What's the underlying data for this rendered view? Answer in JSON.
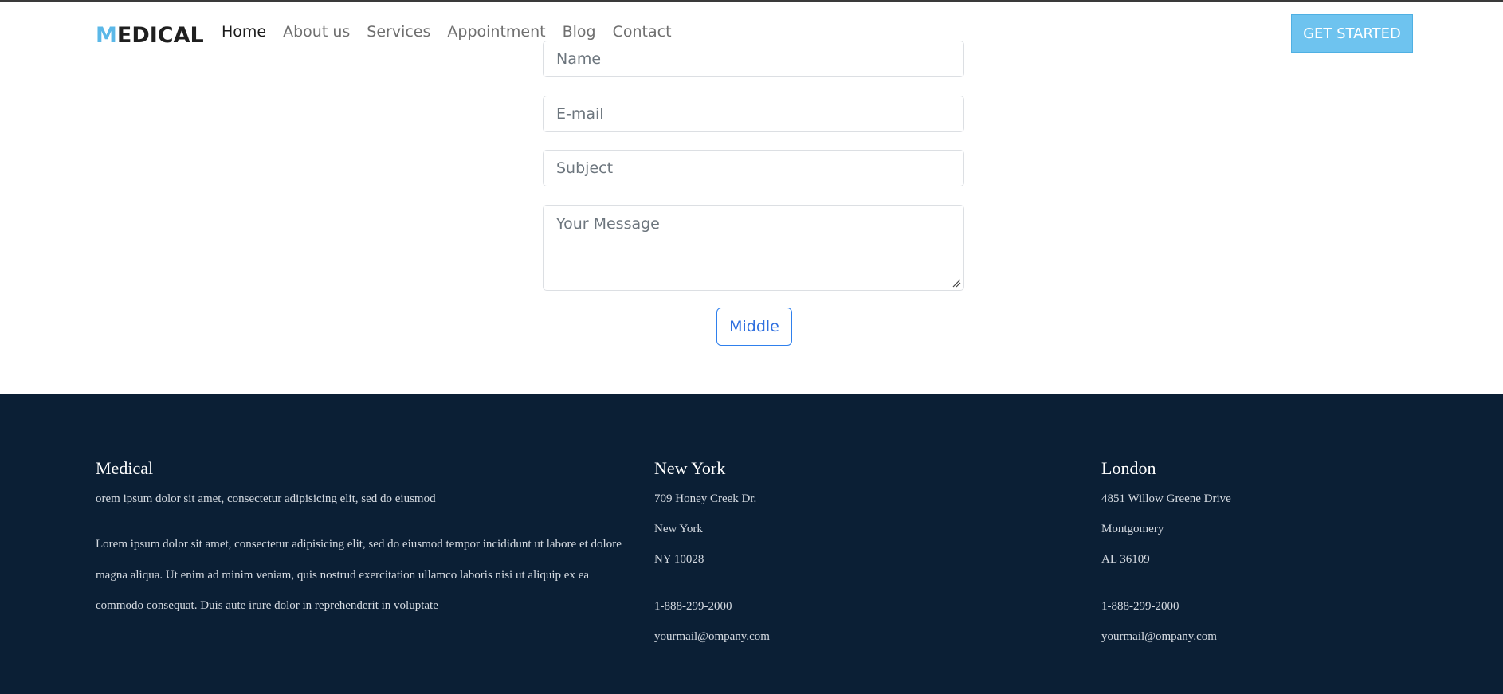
{
  "header": {
    "logo_first": "M",
    "logo_rest": "EDICAL",
    "nav": [
      "Home",
      "About us",
      "Services",
      "Appointment",
      "Blog",
      "Contact"
    ],
    "cta_label": "GET STARTED"
  },
  "form": {
    "name_placeholder": "Name",
    "email_placeholder": "E-mail",
    "subject_placeholder": "Subject",
    "message_placeholder": "Your Message",
    "submit_label": "Middle"
  },
  "footer": {
    "col1": {
      "title": "Medical",
      "tagline": "orem ipsum dolor sit amet, consectetur adipisicing elit, sed do eiusmod",
      "body": "Lorem ipsum dolor sit amet, consectetur adipisicing elit, sed do eiusmod tempor incididunt ut labore et dolore magna aliqua. Ut enim ad minim veniam, quis nostrud exercitation ullamco laboris nisi ut aliquip ex ea commodo consequat. Duis aute irure dolor in reprehenderit in voluptate"
    },
    "col2": {
      "title": "New York",
      "address": [
        "709 Honey Creek Dr.",
        "New York",
        "NY 10028"
      ],
      "phone": "1-888-299-2000",
      "email": "yourmail@ompany.com"
    },
    "col3": {
      "title": "London",
      "address": [
        "4851 Willow Greene Drive",
        "Montgomery",
        "AL 36109"
      ],
      "phone": "1-888-299-2000",
      "email": "yourmail@ompany.com"
    }
  },
  "colors": {
    "accent": "#6ec3ef",
    "footer_bg": "#0b1f35",
    "button_border": "#2f80ed"
  }
}
